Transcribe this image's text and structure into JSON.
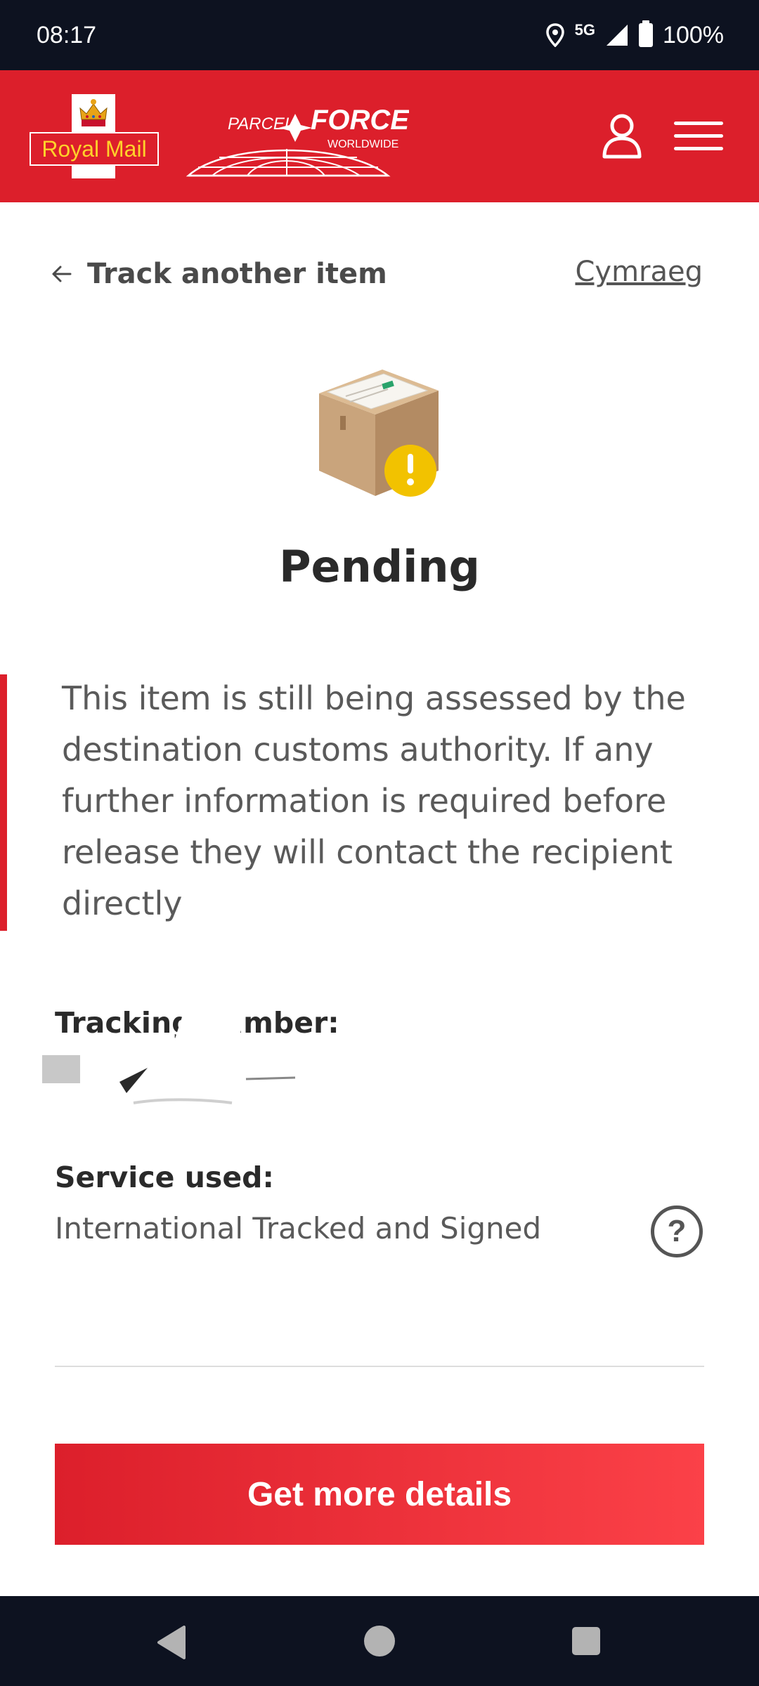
{
  "status_bar": {
    "time": "08:17",
    "network": "5G",
    "battery": "100%",
    "icons": [
      "location-icon",
      "signal-icon",
      "battery-icon"
    ]
  },
  "header": {
    "royal_mail_logo_text": "Royal Mail",
    "parcelforce_logo_text": "PARCELFORCE WORLDWIDE",
    "icons": [
      "account-icon",
      "menu-icon"
    ],
    "brand_color": "#dc1f2b"
  },
  "nav": {
    "back_label": "Track another item",
    "language_label": "Cymraeg"
  },
  "status": {
    "title": "Pending",
    "icon": "parcel-warning-icon",
    "message": "This item is still being assessed by the destination customs authority. If any further information is required before release they will contact the recipient directly"
  },
  "tracking": {
    "label": "Tracking number:"
  },
  "service": {
    "label": "Service used:",
    "value": "International Tracked and Signed"
  },
  "cta": {
    "label": "Get more details"
  }
}
